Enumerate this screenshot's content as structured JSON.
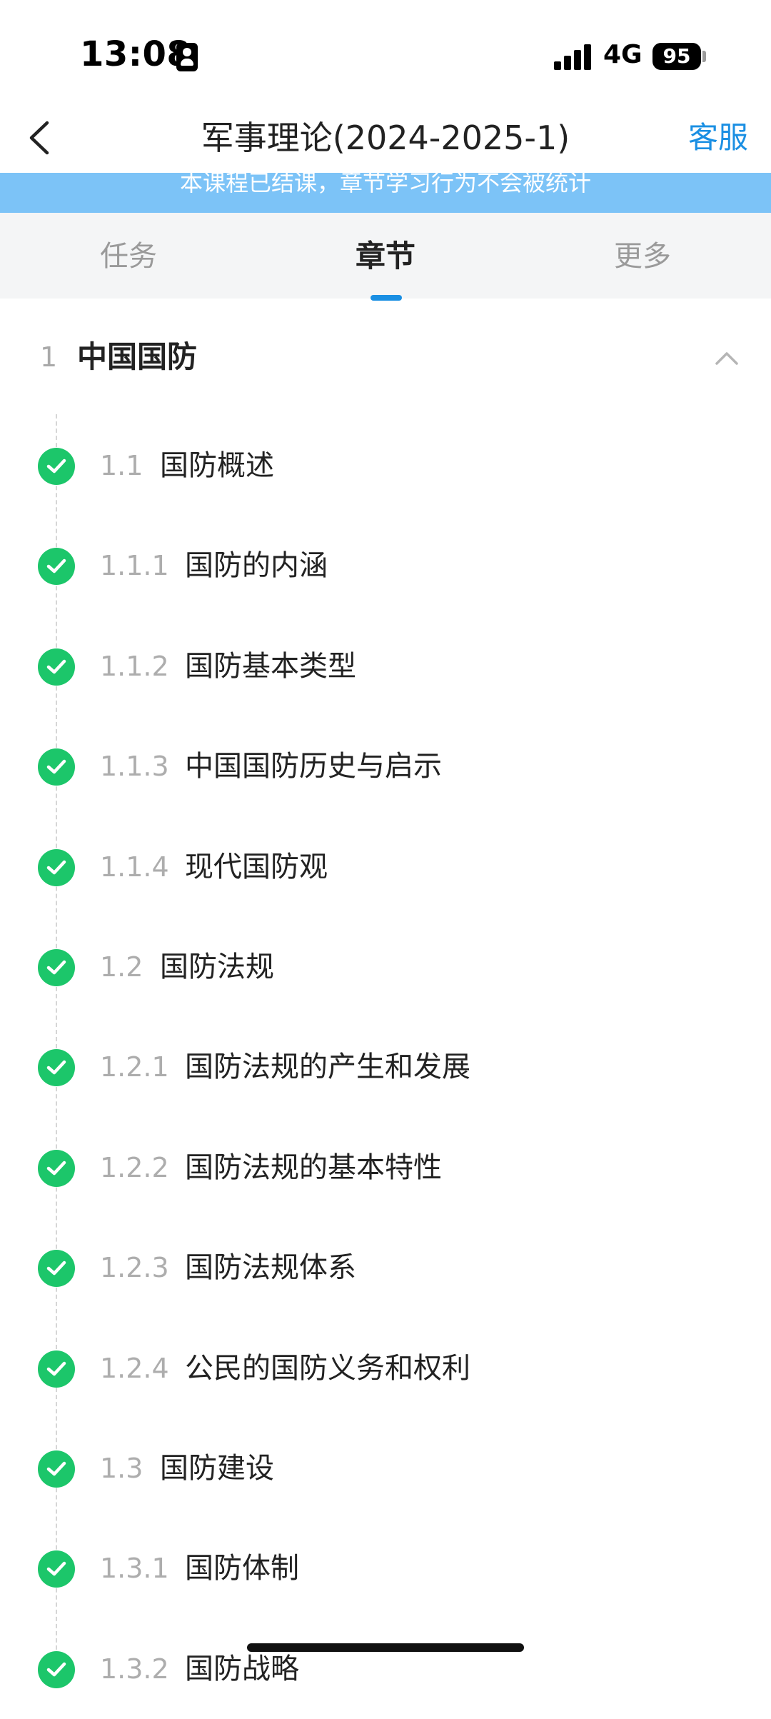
{
  "status": {
    "time": "13:08",
    "network": "4G",
    "battery": "95"
  },
  "nav": {
    "title": "军事理论(2024-2025-1)",
    "service": "客服"
  },
  "banner": {
    "text": "本课程已结课，章节学习行为不会被统计"
  },
  "tabs": [
    {
      "label": "任务"
    },
    {
      "label": "章节"
    },
    {
      "label": "更多"
    }
  ],
  "active_tab": "章节",
  "chapter": {
    "num": "1",
    "title": "中国国防"
  },
  "sections": [
    {
      "num": "1.1",
      "title": "国防概述",
      "completed": true
    },
    {
      "num": "1.1.1",
      "title": "国防的内涵",
      "completed": true
    },
    {
      "num": "1.1.2",
      "title": "国防基本类型",
      "completed": true
    },
    {
      "num": "1.1.3",
      "title": "中国国防历史与启示",
      "completed": true
    },
    {
      "num": "1.1.4",
      "title": "现代国防观",
      "completed": true
    },
    {
      "num": "1.2",
      "title": "国防法规",
      "completed": true
    },
    {
      "num": "1.2.1",
      "title": "国防法规的产生和发展",
      "completed": true
    },
    {
      "num": "1.2.2",
      "title": "国防法规的基本特性",
      "completed": true
    },
    {
      "num": "1.2.3",
      "title": "国防法规体系",
      "completed": true
    },
    {
      "num": "1.2.4",
      "title": "公民的国防义务和权利",
      "completed": true
    },
    {
      "num": "1.3",
      "title": "国防建设",
      "completed": true
    },
    {
      "num": "1.3.1",
      "title": "国防体制",
      "completed": true
    },
    {
      "num": "1.3.2",
      "title": "国防战略",
      "completed": true
    }
  ],
  "colors": {
    "accent": "#1a8fe3",
    "check": "#1cc66a",
    "banner": "#7cc3f7"
  }
}
